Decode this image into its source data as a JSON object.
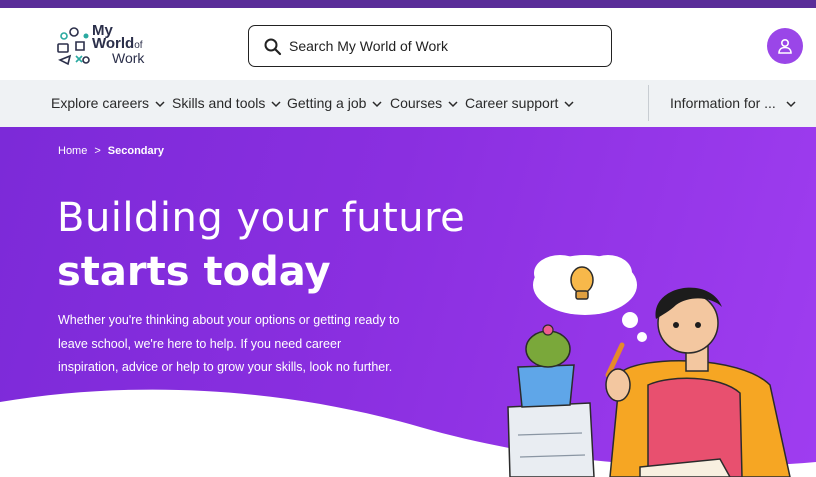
{
  "logo": {
    "line1": "My",
    "line2": "World",
    "line2_small": "of",
    "line3": "Work",
    "icon": "career-icons-cluster"
  },
  "search": {
    "placeholder": "Search My World of Work",
    "value": "",
    "icon": "search-icon"
  },
  "account": {
    "icon": "user-icon"
  },
  "nav": {
    "items": [
      {
        "label": "Explore careers"
      },
      {
        "label": "Skills and tools"
      },
      {
        "label": "Getting a job"
      },
      {
        "label": "Courses"
      },
      {
        "label": "Career support"
      }
    ],
    "info_label": "Information for ..."
  },
  "breadcrumb": {
    "home": "Home",
    "separator": ">",
    "current": "Secondary"
  },
  "hero": {
    "title_line1": "Building your future",
    "title_line2": "starts today",
    "intro": "Whether you're thinking about your options or getting ready to leave school, we're here to help. If you need career inspiration, advice or help to grow your skills, look no further."
  },
  "colors": {
    "brand_purple": "#7c2ad8",
    "top_bar": "#5a2d99",
    "avatar": "#9a46e8",
    "nav_bg": "#eff2f4"
  }
}
